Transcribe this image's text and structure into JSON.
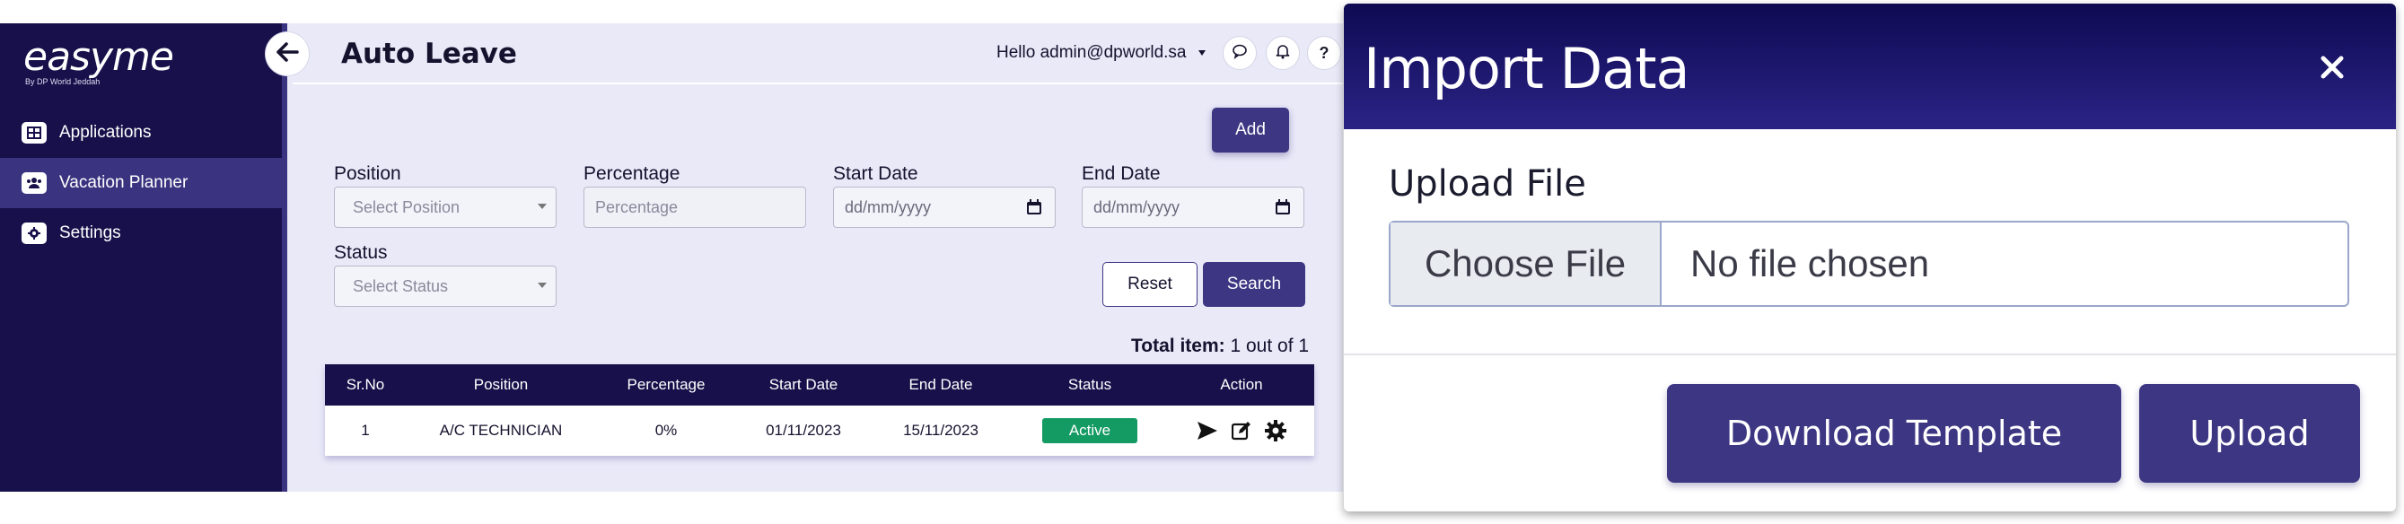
{
  "brand": {
    "name": "easyme",
    "tagline": "By DP World Jeddah"
  },
  "sidebar": {
    "items": [
      {
        "label": "Applications",
        "icon": "grid-icon"
      },
      {
        "label": "Vacation Planner",
        "icon": "users-icon",
        "active": true
      },
      {
        "label": "Settings",
        "icon": "gear-icon"
      }
    ]
  },
  "header": {
    "title": "Auto Leave",
    "user": "Hello admin@dpworld.sa",
    "help_label": "?"
  },
  "toolbar": {
    "add_label": "Add"
  },
  "filters": {
    "position": {
      "label": "Position",
      "placeholder": "Select Position"
    },
    "percentage": {
      "label": "Percentage",
      "placeholder": "Percentage"
    },
    "start_date": {
      "label": "Start Date",
      "placeholder": "dd/mm/yyyy"
    },
    "end_date": {
      "label": "End Date",
      "placeholder": "dd/mm/yyyy"
    },
    "status": {
      "label": "Status",
      "placeholder": "Select Status"
    },
    "reset_label": "Reset",
    "search_label": "Search"
  },
  "summary": {
    "total_label": "Total item:",
    "total_value": "1 out of 1"
  },
  "table": {
    "columns": [
      "Sr.No",
      "Position",
      "Percentage",
      "Start Date",
      "End Date",
      "Status",
      "Action"
    ],
    "rows": [
      {
        "sr": "1",
        "position": "A/C TECHNICIAN",
        "percentage": "0%",
        "start": "01/11/2023",
        "end": "15/11/2023",
        "status": "Active"
      }
    ]
  },
  "modal": {
    "title": "Import Data",
    "upload_label": "Upload File",
    "choose_label": "Choose File",
    "file_status": "No file chosen",
    "download_label": "Download Template",
    "upload_button": "Upload"
  },
  "colors": {
    "sidebar_bg": "#17104a",
    "accent": "#3d3783",
    "page_bg": "#e9e9f8",
    "status_active": "#149a63"
  }
}
